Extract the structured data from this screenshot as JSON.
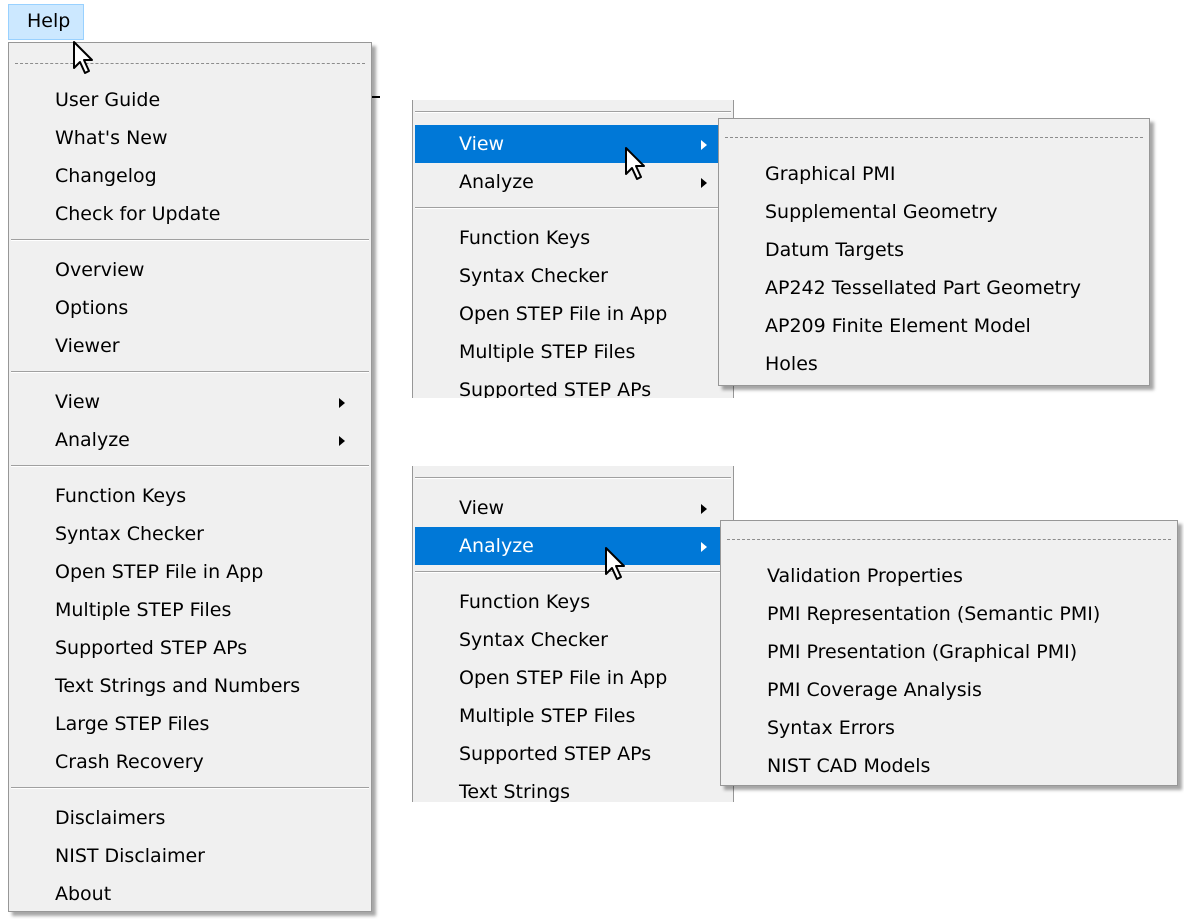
{
  "help_menu": {
    "title": "Help",
    "items_group1": [
      "User Guide",
      "What's New",
      "Changelog",
      "Check for Update"
    ],
    "items_group2": [
      "Overview",
      "Options",
      "Viewer"
    ],
    "items_group3": [
      "View",
      "Analyze"
    ],
    "items_group4": [
      "Function Keys",
      "Syntax Checker",
      "Open STEP File in App",
      "Multiple STEP Files",
      "Supported STEP APs",
      "Text Strings and Numbers",
      "Large STEP Files",
      "Crash Recovery"
    ],
    "items_group5": [
      "Disclaimers",
      "NIST Disclaimer",
      "About"
    ]
  },
  "crop_view": {
    "items": [
      "View",
      "Analyze"
    ],
    "items_lower": [
      "Function Keys",
      "Syntax Checker",
      "Open STEP File in App",
      "Multiple STEP Files",
      "Supported STEP APs"
    ],
    "submenu": [
      "Graphical PMI",
      "Supplemental Geometry",
      "Datum Targets",
      "AP242 Tessellated Part Geometry",
      "AP209 Finite Element Model",
      "Holes"
    ]
  },
  "crop_analyze": {
    "items": [
      "View",
      "Analyze"
    ],
    "items_lower": [
      "Function Keys",
      "Syntax Checker",
      "Open STEP File in App",
      "Multiple STEP Files",
      "Supported STEP APs",
      "Text Strings"
    ],
    "submenu": [
      "Validation Properties",
      "PMI Representation (Semantic PMI)",
      "PMI Presentation (Graphical PMI)",
      "PMI Coverage Analysis",
      "Syntax Errors",
      "NIST CAD Models"
    ]
  },
  "colors": {
    "highlight": "#0078d7",
    "menu_bg": "#f0f0f0",
    "menubar_hover": "#cce8ff"
  },
  "icons": [
    "arrow-cursor-icon",
    "submenu-arrow-icon"
  ]
}
